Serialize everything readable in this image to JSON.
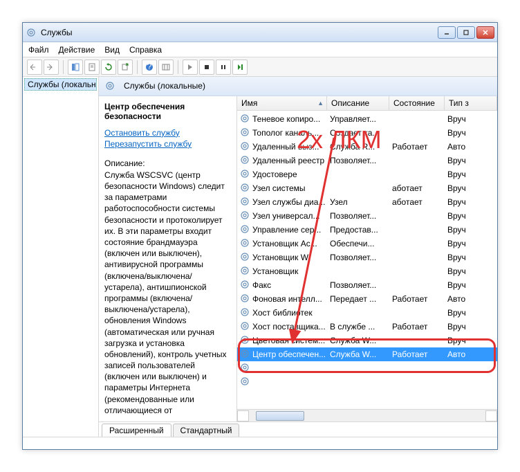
{
  "window": {
    "title": "Службы"
  },
  "menu": {
    "file": "Файл",
    "action": "Действие",
    "view": "Вид",
    "help": "Справка"
  },
  "tree": {
    "root": "Службы (локальн"
  },
  "main_header": "Службы (локальные)",
  "detail": {
    "title": "Центр обеспечения безопасности",
    "stop_link": "Остановить службу",
    "restart_link": "Перезапустить службу",
    "desc_label": "Описание:",
    "desc": "Служба WSCSVC (центр безопасности Windows) следит за параметрами работоспособности системы безопасности и протоколирует их. В эти параметры входит состояние брандмауэра (включен или выключен), антивирусной программы (включена/выключена/устарела), антишпионской программы (включена/выключена/устарела), обновления Windows (автоматическая или ручная загрузка и установка обновлений), контроль учетных записей пользователей (включен или выключен) и параметры Интернета (рекомендованные или отличающиеся от"
  },
  "columns": {
    "name": "Имя",
    "desc": "Описание",
    "state": "Состояние",
    "type": "Тип з"
  },
  "services": [
    {
      "name": "Теневое копиро...",
      "desc": "Управляет...",
      "state": "",
      "type": "Вруч"
    },
    {
      "name": "Тополог каналь...",
      "desc": "Создает ка...",
      "state": "",
      "type": "Вруч"
    },
    {
      "name": "Удаленный выз...",
      "desc": "Служба R...",
      "state": "Работает",
      "type": "Авто"
    },
    {
      "name": "Удаленный реестр",
      "desc": "Позволяет...",
      "state": "",
      "type": "Вруч"
    },
    {
      "name": "Удостовере",
      "desc": "",
      "state": "",
      "type": "Вруч"
    },
    {
      "name": "Узел системы",
      "desc": "",
      "state": "аботает",
      "type": "Вруч"
    },
    {
      "name": "Узел службы диа...",
      "desc": "Узел",
      "state": "аботает",
      "type": "Вруч"
    },
    {
      "name": "Узел универсал...",
      "desc": "Позволяет...",
      "state": "",
      "type": "Вруч"
    },
    {
      "name": "Управление сер...",
      "desc": "Предостав...",
      "state": "",
      "type": "Вруч"
    },
    {
      "name": "Установщик Ac...",
      "desc": "Обеспечи...",
      "state": "",
      "type": "Вруч"
    },
    {
      "name": "Установщик W",
      "desc": "Позволяет...",
      "state": "",
      "type": "Вруч"
    },
    {
      "name": "Установщик",
      "desc": "",
      "state": "",
      "type": "Вруч"
    },
    {
      "name": "Факс",
      "desc": "Позволяет...",
      "state": "",
      "type": "Вруч"
    },
    {
      "name": "Фоновая интелл...",
      "desc": "Передает ...",
      "state": "Работает",
      "type": "Авто"
    },
    {
      "name": "Хост библиотек",
      "desc": "",
      "state": "",
      "type": "Вруч"
    },
    {
      "name": "Хост поставщика...",
      "desc": "В службе ...",
      "state": "Работает",
      "type": "Вруч"
    },
    {
      "name": "Цветовая систем...",
      "desc": "Служба W...",
      "state": "",
      "type": "Вруч"
    },
    {
      "name": "Центр обеспечен...",
      "desc": "Служба W...",
      "state": "Работает",
      "type": "Авто",
      "selected": true
    },
    {
      "name": "",
      "desc": "",
      "state": "",
      "type": ""
    },
    {
      "name": "",
      "desc": "",
      "state": "",
      "type": ""
    }
  ],
  "tabs": {
    "extended": "Расширенный",
    "standard": "Стандартный"
  },
  "annotation": {
    "text": "2x ЛКМ"
  }
}
